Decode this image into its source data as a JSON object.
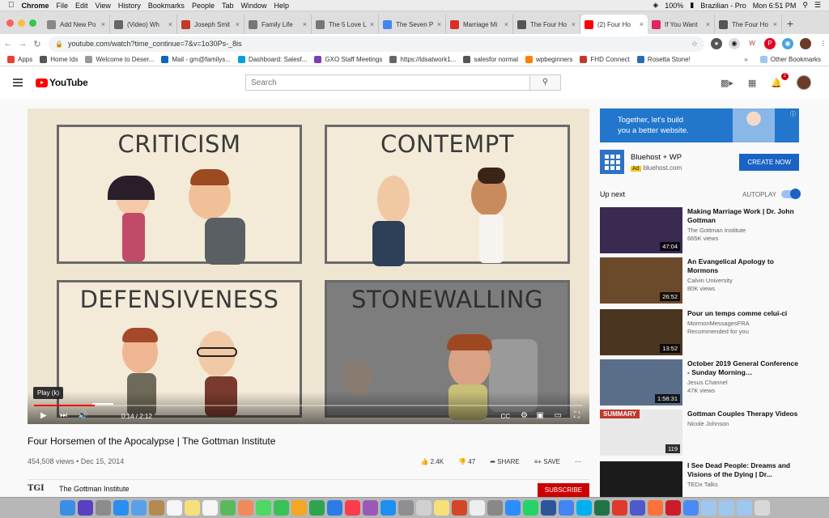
{
  "menubar": {
    "app": "Chrome",
    "items": [
      "File",
      "Edit",
      "View",
      "History",
      "Bookmarks",
      "People",
      "Tab",
      "Window",
      "Help"
    ],
    "battery": "100%",
    "language": "Brazilian - Pro",
    "clock": "Mon 6:51 PM"
  },
  "tabs": [
    {
      "title": "Add New Po",
      "icon": "wordpress-icon",
      "color": "#888888"
    },
    {
      "title": "(Video) Wh",
      "icon": "video-icon",
      "color": "#666666"
    },
    {
      "title": "Joseph Smit",
      "icon": "bookmark-icon",
      "color": "#c0392b"
    },
    {
      "title": "Family Life",
      "icon": "doc-icon",
      "color": "#777777"
    },
    {
      "title": "The 5 Love L",
      "icon": "doc-icon",
      "color": "#777777"
    },
    {
      "title": "The Seven P",
      "icon": "google-icon",
      "color": "#4285f4"
    },
    {
      "title": "Marriage Mi",
      "icon": "gmail-icon",
      "color": "#d93025"
    },
    {
      "title": "The Four Ho",
      "icon": "tgi-icon",
      "color": "#555555"
    },
    {
      "title": "(2) Four Ho",
      "icon": "youtube-icon",
      "color": "#ff0000",
      "active": true
    },
    {
      "title": "If You Want",
      "icon": "heart-icon",
      "color": "#e0245e"
    },
    {
      "title": "The Four Ho",
      "icon": "tgi-icon",
      "color": "#555555"
    }
  ],
  "address": {
    "url": "youtube.com/watch?time_continue=7&v=1o30Ps-_8is"
  },
  "bookmarks": [
    {
      "label": "Apps",
      "color": "#e94235"
    },
    {
      "label": "Home Ids",
      "color": "#555555"
    },
    {
      "label": "Welcome to Deser...",
      "color": "#999999"
    },
    {
      "label": "Mail - gm@familys...",
      "color": "#0a64c2"
    },
    {
      "label": "Dashboard: Salesf...",
      "color": "#00a1e0"
    },
    {
      "label": "GXO Staff Meetings",
      "color": "#7b3fb4"
    },
    {
      "label": "https://ldsatwork1...",
      "color": "#666666"
    },
    {
      "label": "salesfor normal",
      "color": "#555555"
    },
    {
      "label": "wpbeginners",
      "color": "#ff7f00"
    },
    {
      "label": "FHD Connect",
      "color": "#c0392b"
    },
    {
      "label": "Rosetta Stone!",
      "color": "#2a6cb0"
    }
  ],
  "bookmarks_more": "Other Bookmarks",
  "youtube": {
    "brand": "YouTube",
    "search_placeholder": "Search",
    "notifications": "2"
  },
  "video": {
    "panels": [
      "CRITICISM",
      "CONTEMPT",
      "DEFENSIVENESS",
      "STONEWALLING"
    ],
    "tooltip": "Play (k)",
    "time": "0:14 / 2:12",
    "progress": 0.11,
    "title": "Four Horsemen of the Apocalypse | The Gottman Institute",
    "meta": "454,508 views • Dec 15, 2014",
    "likes": "2.4K",
    "dislikes": "47",
    "share": "SHARE",
    "save": "SAVE"
  },
  "channel": {
    "logo": "TGI",
    "name": "The Gottman Institute",
    "subscribe": "SUBSCRIBE"
  },
  "ad": {
    "banner": "Together, let's build\nyou a better website.",
    "title": "Bluehost + WP",
    "badge": "Ad",
    "domain": "bluehost.com",
    "cta": "CREATE NOW"
  },
  "upnext": {
    "label": "Up next",
    "autoplay": "AUTOPLAY"
  },
  "recs": [
    {
      "title": "Making Marriage Work | Dr. John Gottman",
      "channel": "The Gottman Institute",
      "views": "665K views",
      "duration": "47:04",
      "bg": "#3b2a4f"
    },
    {
      "title": "An Evangelical Apology to Mormons",
      "channel": "Calvin University",
      "views": "80K views",
      "duration": "26:52",
      "bg": "#6b4a2c"
    },
    {
      "title": "Pour un temps comme celui-ci",
      "channel": "MormonMessagesFRA",
      "views": "Recommended for you",
      "duration": "13:52",
      "bg": "#4a3620"
    },
    {
      "title": "October 2019 General Conference - Sunday Morning…",
      "channel": "Jesus Channel",
      "views": "47K views",
      "duration": "1:58:31",
      "bg": "#5a6e8a"
    },
    {
      "title": "Gottman Couples Therapy Videos",
      "channel": "Nicole Johnson",
      "views": "",
      "duration": "119",
      "thumb_label": "SUMMARY",
      "bg": "#e8e8e8"
    },
    {
      "title": "I See Dead People: Dreams and Visions of the Dying | Dr...",
      "channel": "TEDx Talks",
      "views": "",
      "duration": "",
      "bg": "#1b1b1b"
    }
  ],
  "dock": [
    {
      "icon": "finder-icon",
      "color": "#3a8ee6"
    },
    {
      "icon": "siri-icon",
      "color": "#5a3fbf"
    },
    {
      "icon": "launchpad-icon",
      "color": "#8c8c8c"
    },
    {
      "icon": "safari-icon",
      "color": "#2a8df0"
    },
    {
      "icon": "mail-icon",
      "color": "#5aa0e8"
    },
    {
      "icon": "contacts-icon",
      "color": "#b58a52"
    },
    {
      "icon": "calendar-icon",
      "color": "#f5f5f5"
    },
    {
      "icon": "notes-icon",
      "color": "#f7e07a"
    },
    {
      "icon": "reminders-icon",
      "color": "#f5f5f5"
    },
    {
      "icon": "maps-icon",
      "color": "#5cb85c"
    },
    {
      "icon": "photos-icon",
      "color": "#f08a5d"
    },
    {
      "icon": "messages-icon",
      "color": "#4cd964"
    },
    {
      "icon": "facetime-icon",
      "color": "#3ac058"
    },
    {
      "icon": "pages-icon",
      "color": "#f5a623"
    },
    {
      "icon": "numbers-icon",
      "color": "#2ea44f"
    },
    {
      "icon": "keynote-icon",
      "color": "#2d7be5"
    },
    {
      "icon": "music-icon",
      "color": "#fa3c4c"
    },
    {
      "icon": "podcasts-icon",
      "color": "#9b59b6"
    },
    {
      "icon": "appstore-icon",
      "color": "#1f8ef1"
    },
    {
      "icon": "settings-icon",
      "color": "#8e8e93"
    },
    {
      "icon": "preview-icon",
      "color": "#d0d0d0"
    },
    {
      "icon": "stickies-icon",
      "color": "#f7e07a"
    },
    {
      "icon": "powerpoint-icon",
      "color": "#d24726"
    },
    {
      "icon": "textedit-icon",
      "color": "#eeeeee"
    },
    {
      "icon": "script-icon",
      "color": "#888888"
    },
    {
      "icon": "zoom-icon",
      "color": "#2d8cff"
    },
    {
      "icon": "whatsapp-icon",
      "color": "#25d366"
    },
    {
      "icon": "word-icon",
      "color": "#2b579a"
    },
    {
      "icon": "chrome-icon",
      "color": "#4285f4"
    },
    {
      "icon": "skype-icon",
      "color": "#00aff0"
    },
    {
      "icon": "excel-icon",
      "color": "#217346"
    },
    {
      "icon": "acrobat-icon",
      "color": "#e03a2c"
    },
    {
      "icon": "teams-icon",
      "color": "#5059c9"
    },
    {
      "icon": "firefox-icon",
      "color": "#ff7139"
    },
    {
      "icon": "opera-icon",
      "color": "#cc1b2b"
    },
    {
      "icon": "drive-icon",
      "color": "#4a8af4"
    },
    {
      "icon": "folder-icon",
      "color": "#9fc7ee"
    },
    {
      "icon": "folder-icon",
      "color": "#9fc7ee"
    },
    {
      "icon": "folder-icon",
      "color": "#9fc7ee"
    },
    {
      "icon": "trash-icon",
      "color": "#d8d8d8"
    }
  ]
}
